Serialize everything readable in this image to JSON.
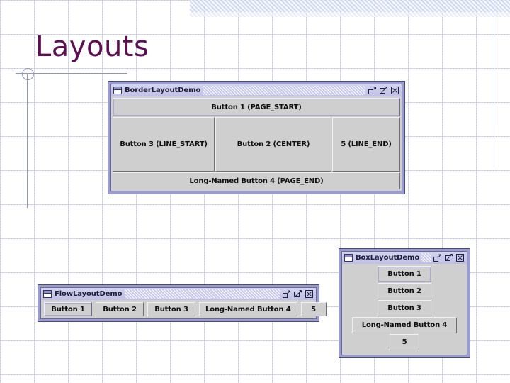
{
  "slide": {
    "title": "Layouts",
    "title_color": "#5c1050",
    "background": "#ffffff"
  },
  "decor": {
    "band_color": "#c7d3ef",
    "line_color": "#8d97bd",
    "circle_icon": "circle-decoration"
  },
  "windows": [
    {
      "id": "border",
      "title": "BorderLayoutDemo",
      "icon": "window-frame-icon",
      "controls": [
        {
          "name": "minimize-button",
          "glyph": "minimize"
        },
        {
          "name": "maximize-button",
          "glyph": "maximize"
        },
        {
          "name": "close-button",
          "glyph": "close"
        }
      ],
      "buttons": {
        "page_start": "Button 1 (PAGE_START)",
        "line_start": "Button 3 (LINE_START)",
        "center": "Button 2 (CENTER)",
        "line_end": "5 (LINE_END)",
        "page_end": "Long-Named Button 4 (PAGE_END)"
      }
    },
    {
      "id": "flow",
      "title": "FlowLayoutDemo",
      "icon": "window-frame-icon",
      "controls": [
        {
          "name": "minimize-button",
          "glyph": "minimize"
        },
        {
          "name": "maximize-button",
          "glyph": "maximize"
        },
        {
          "name": "close-button",
          "glyph": "close"
        }
      ],
      "buttons": [
        "Button 1",
        "Button 2",
        "Button 3",
        "Long-Named Button 4",
        "5"
      ]
    },
    {
      "id": "box",
      "title": "BoxLayoutDemo",
      "icon": "window-frame-icon",
      "controls": [
        {
          "name": "minimize-button",
          "glyph": "minimize"
        },
        {
          "name": "maximize-button",
          "glyph": "maximize"
        },
        {
          "name": "close-button",
          "glyph": "close"
        }
      ],
      "buttons": [
        "Button 1",
        "Button 2",
        "Button 3",
        "Long-Named Button 4",
        "5"
      ]
    }
  ]
}
